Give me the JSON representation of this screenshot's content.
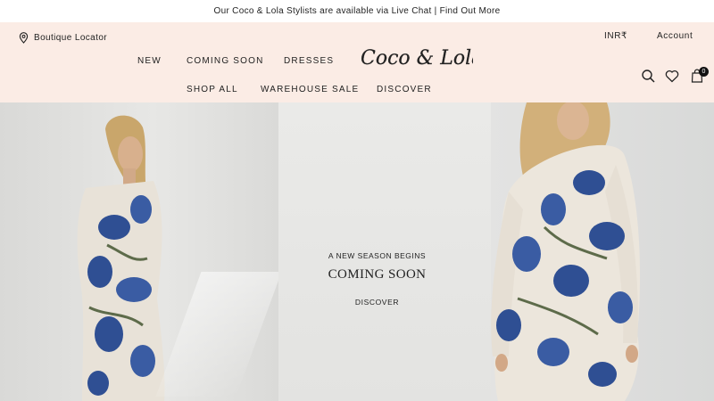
{
  "announcement": "Our Coco & Lola Stylists are available via Live Chat | Find Out More",
  "header": {
    "locator_label": "Boutique Locator",
    "currency": "INR₹",
    "account": "Account",
    "logo_text": "Coco & Lola",
    "cart_count": "0",
    "icons": [
      "location-pin-icon",
      "search-icon",
      "heart-icon",
      "bag-icon"
    ]
  },
  "nav": {
    "row1": [
      "NEW",
      "COMING SOON",
      "DRESSES"
    ],
    "row2": [
      "SHOP ALL",
      "WAREHOUSE SALE",
      "DISCOVER"
    ]
  },
  "hero": {
    "kicker": "A NEW SEASON BEGINS",
    "headline": "COMING SOON",
    "cta": "DISCOVER"
  },
  "colors": {
    "header_bg": "#fbece5",
    "text": "#222222",
    "dress_blue": "#2f4f93"
  }
}
